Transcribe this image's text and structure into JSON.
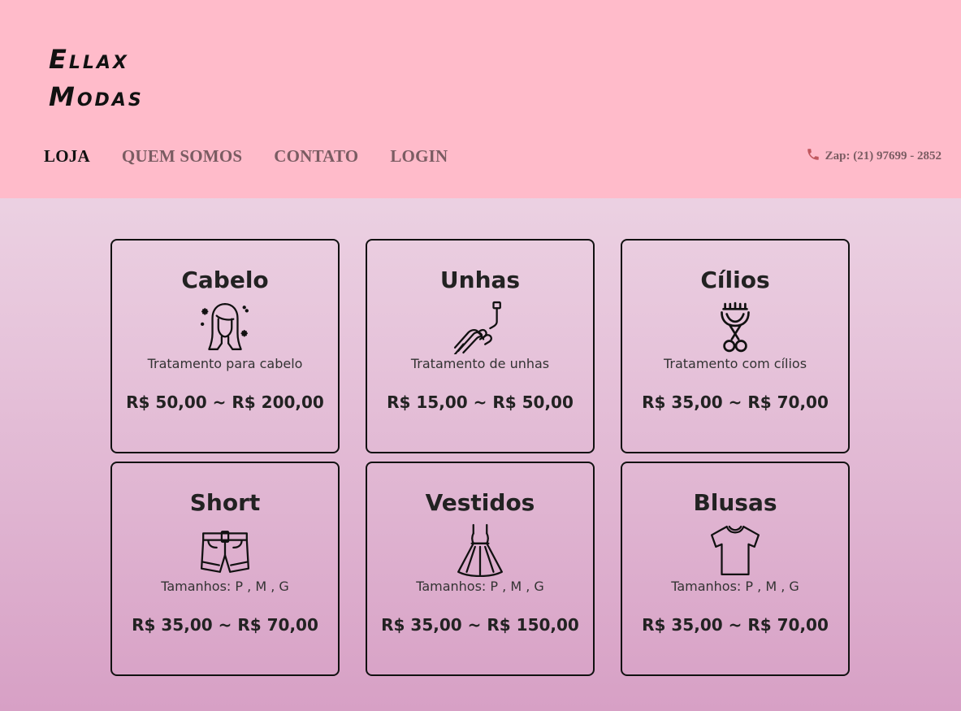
{
  "brand": {
    "line1": "Ellax",
    "line2": "Modas"
  },
  "nav": {
    "items": [
      {
        "label": "LOJA",
        "active": true
      },
      {
        "label": "QUEM SOMOS",
        "active": false
      },
      {
        "label": "CONTATO",
        "active": false
      },
      {
        "label": "LOGIN",
        "active": false
      }
    ]
  },
  "contact": {
    "zap": "Zap: (21) 97699 - 2852",
    "icon": "phone-icon"
  },
  "cards": [
    {
      "title": "Cabelo",
      "icon": "hair-icon",
      "desc": "Tratamento para cabelo",
      "price": "R$ 50,00 ~ R$ 200,00"
    },
    {
      "title": "Unhas",
      "icon": "nails-icon",
      "desc": "Tratamento de unhas",
      "price": "R$ 15,00 ~ R$ 50,00"
    },
    {
      "title": "Cílios",
      "icon": "eyelash-curler-icon",
      "desc": "Tratamento com cílios",
      "price": "R$ 35,00 ~ R$ 70,00"
    },
    {
      "title": "Short",
      "icon": "shorts-icon",
      "desc": "Tamanhos: P , M , G",
      "price": "R$ 35,00 ~ R$ 70,00"
    },
    {
      "title": "Vestidos",
      "icon": "dress-icon",
      "desc": "Tamanhos: P , M , G",
      "price": "R$ 35,00 ~ R$ 150,00"
    },
    {
      "title": "Blusas",
      "icon": "tshirt-icon",
      "desc": "Tamanhos: P , M , G",
      "price": "R$ 35,00 ~ R$ 70,00"
    }
  ],
  "colors": {
    "header": "#ffbbca",
    "nav_inactive": "#7a5c62",
    "nav_active": "#111111"
  }
}
